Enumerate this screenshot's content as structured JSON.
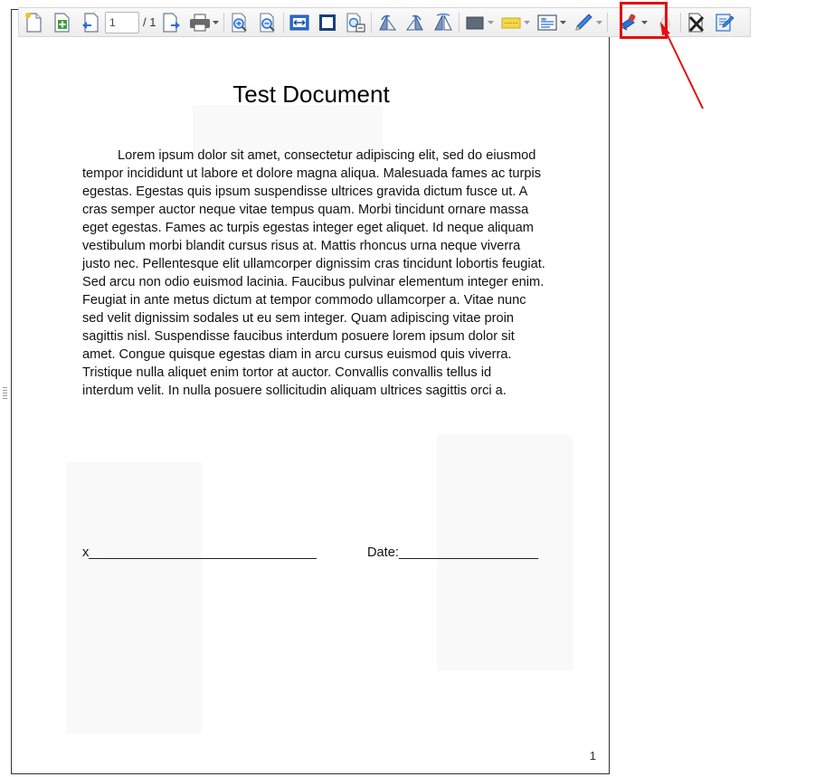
{
  "toolbar": {
    "current_page": "1",
    "total_pages": "/ 1",
    "buttons": [
      "new-document",
      "add-page",
      "previous-page",
      "next-page",
      "print",
      "zoom-in",
      "zoom-out",
      "fit-width",
      "fit-page",
      "page-setup",
      "rotate-left",
      "rotate-right",
      "flip",
      "rectangle-color",
      "highlight-text",
      "text-box",
      "pen",
      "stamp",
      "flame",
      "delete",
      "edit-notes"
    ],
    "highlight_color": "#e01010"
  },
  "document": {
    "title": "Test Document",
    "body": "Lorem ipsum dolor sit amet, consectetur adipiscing elit, sed do eiusmod tempor incididunt ut labore et dolore magna aliqua. Malesuada fames ac turpis egestas. Egestas quis ipsum suspendisse ultrices gravida dictum fusce ut. A cras semper auctor neque vitae tempus quam. Morbi tincidunt ornare massa eget egestas. Fames ac turpis egestas integer eget aliquet. Id neque aliquam vestibulum morbi blandit cursus risus at. Mattis rhoncus urna neque viverra justo nec. Pellentesque elit ullamcorper dignissim cras tincidunt lobortis feugiat. Sed arcu non odio euismod lacinia. Faucibus pulvinar elementum integer enim. Feugiat in ante metus dictum at tempor commodo ullamcorper a. Vitae nunc sed velit dignissim sodales ut eu sem integer. Quam adipiscing vitae proin sagittis nisl. Suspendisse faucibus interdum posuere lorem ipsum dolor sit amet. Congue quisque egestas diam in arcu cursus euismod quis viverra. Tristique nulla aliquet enim tortor at auctor. Convallis convallis tellus id interdum velit. In nulla posuere sollicitudin aliquam ultrices sagittis orci a.",
    "signature_line": "x_______________________________",
    "date_line": "Date:___________________",
    "page_number": "1"
  }
}
